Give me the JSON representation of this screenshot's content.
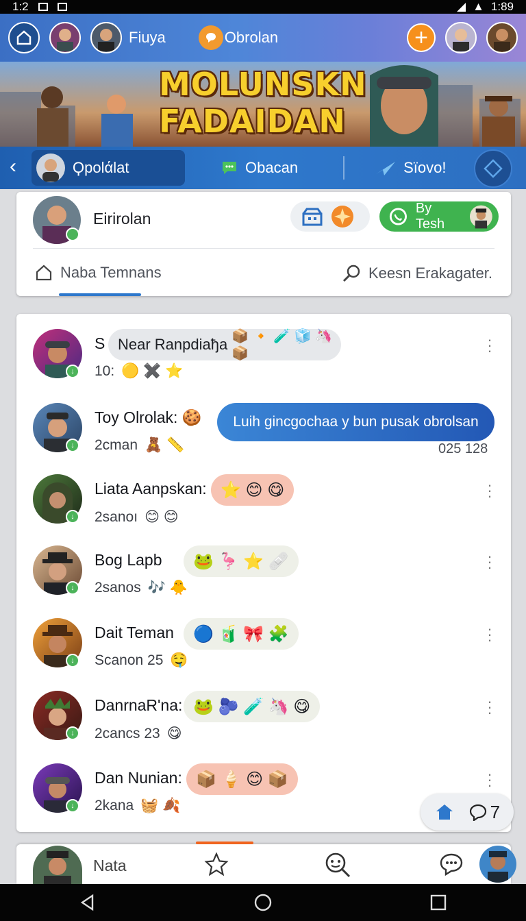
{
  "status": {
    "time": "1:2",
    "battery": "1:89"
  },
  "top": {
    "chip1_label": "Fiuya",
    "chip2_label": "Obrolan"
  },
  "banner": {
    "line1": "MOLUNSKN",
    "line2": "FADAIDAN"
  },
  "tabs": {
    "tab1": "Ϙpolάlat",
    "tab2": "Obacan",
    "tab3": "Sïovo!"
  },
  "profile": {
    "name": "Eirirolan",
    "by_button": "By Tesh",
    "left_link": "Naba Temnans",
    "right_link": "Keesn Erakagater."
  },
  "chats": [
    {
      "name": "S",
      "sub": "10:",
      "pill": "Near Ranpdiaђa",
      "emojis": "📦 🔸 🧪 🧊 🦄 📦",
      "sub_emojis": "🟡 ✖️ ⭐"
    },
    {
      "name": "Toy Olrolak:",
      "sub": "2cman",
      "name_emoji": "🍪",
      "bubble": "Luih gincgochaa y bun pusak obrolsan",
      "time": "025 128",
      "sub_emojis": "🧸 📏"
    },
    {
      "name": "Liata Aanpskan:",
      "sub": "2sanoı",
      "emojis": "⭐ 😊 😋",
      "sub_emojis": "😊 😊"
    },
    {
      "name": "Bog Lapb",
      "sub": "2sanos",
      "emojis": "🐸 🦩 ⭐ 🩹",
      "sub_emojis": "🎶 🐥"
    },
    {
      "name": "Dait Teman",
      "sub": "Scanon 25",
      "emojis": "🔵 🧃 🎀 🧩",
      "sub_emojis": "🤤"
    },
    {
      "name": "DanrnaR'na:",
      "sub": "2cancs 23",
      "emojis": "🐸 🫐 🧪 🦄 😋",
      "sub_emojis": "😋"
    },
    {
      "name": "Dan Nunian:",
      "sub": "2kana",
      "emojis": "📦 🍦 😊 📦",
      "sub_emojis": "🧺 🍂"
    }
  ],
  "float": {
    "count": "7"
  },
  "nav": {
    "label": "Nata"
  },
  "colors": {
    "accent": "#2e78cc",
    "green": "#3fb34f",
    "orange": "#f6901c"
  }
}
